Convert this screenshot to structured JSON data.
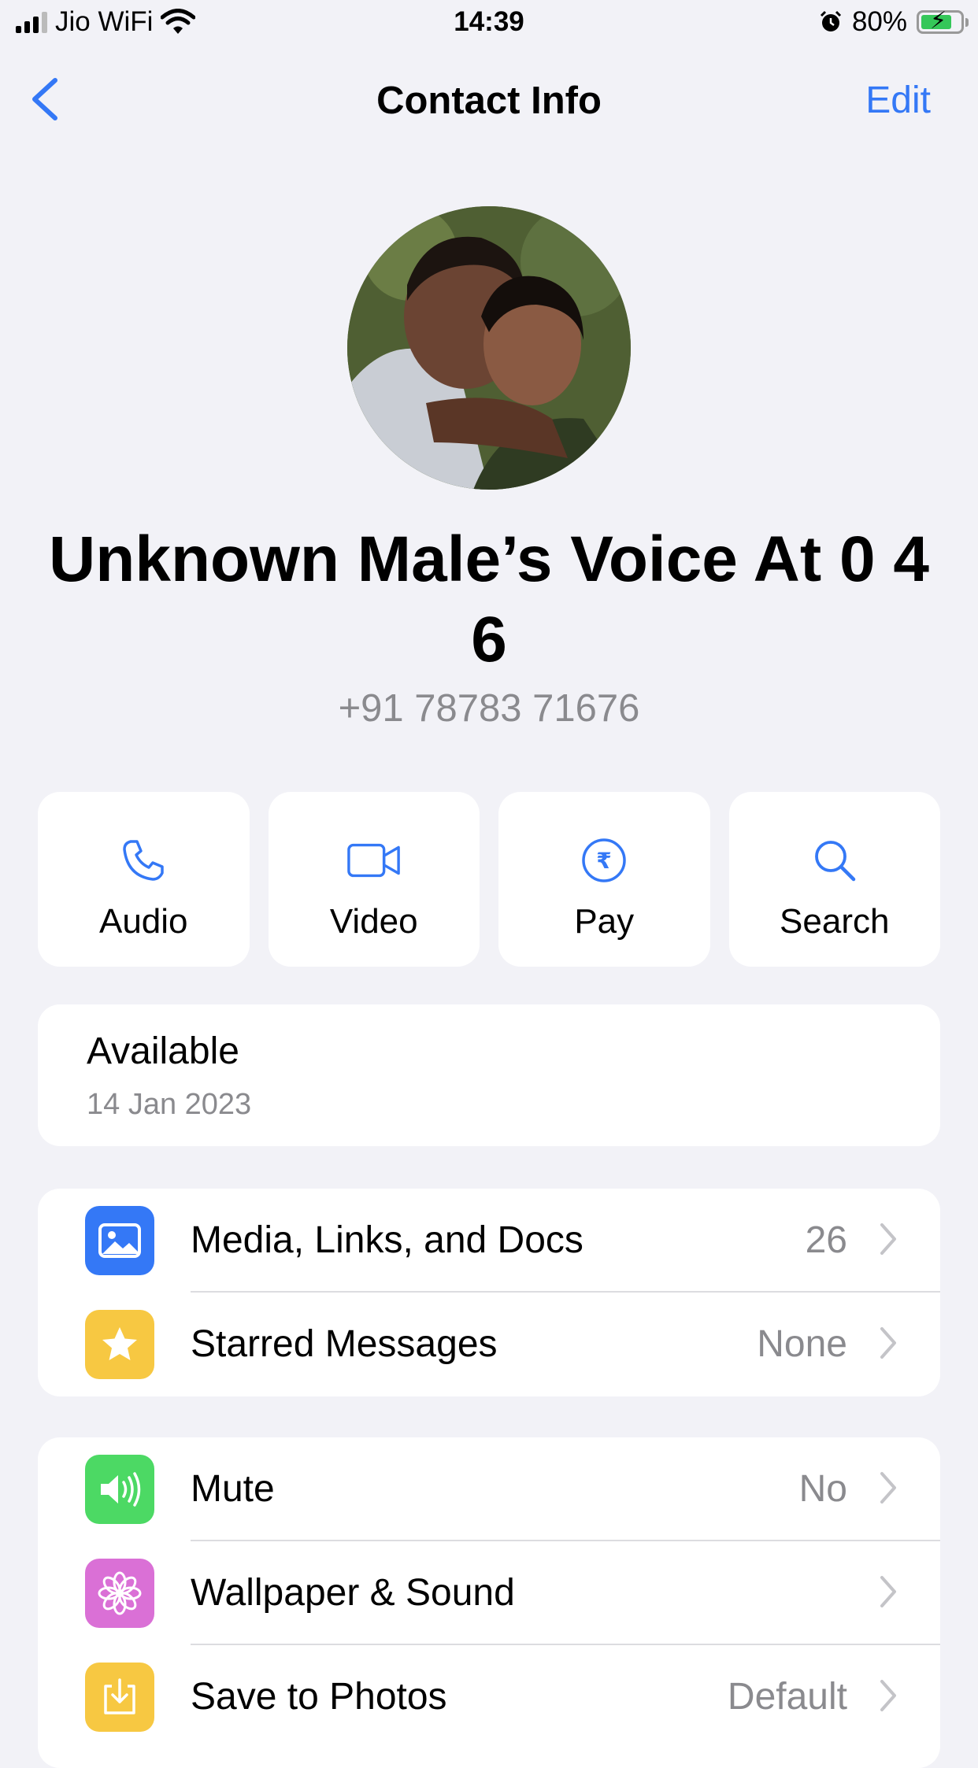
{
  "status_bar": {
    "carrier": "Jio WiFi",
    "time": "14:39",
    "battery": "80%",
    "battery_level": 0.8
  },
  "nav": {
    "title": "Contact Info",
    "edit": "Edit"
  },
  "contact": {
    "name": "Unknown Male’s Voice  At 0 4 6",
    "phone": "+91 78783 71676"
  },
  "actions": [
    {
      "label": "Audio",
      "icon": "phone-icon"
    },
    {
      "label": "Video",
      "icon": "video-icon"
    },
    {
      "label": "Pay",
      "icon": "rupee-icon"
    },
    {
      "label": "Search",
      "icon": "search-icon"
    }
  ],
  "about": {
    "status": "Available",
    "date": "14 Jan 2023"
  },
  "media_section": [
    {
      "label": "Media, Links, and Docs",
      "value": "26",
      "icon": "photo-icon",
      "color": "#3478f6"
    },
    {
      "label": "Starred Messages",
      "value": "None",
      "icon": "star-icon",
      "color": "#f7c842"
    }
  ],
  "settings_section": [
    {
      "label": "Mute",
      "value": "No",
      "icon": "speaker-icon",
      "color": "#4cd964"
    },
    {
      "label": "Wallpaper & Sound",
      "value": "",
      "icon": "flower-icon",
      "color": "#da70d6"
    },
    {
      "label": "Save to Photos",
      "value": "Default",
      "icon": "save-icon",
      "color": "#f7c842"
    }
  ],
  "colors": {
    "accent": "#3478f6",
    "background": "#f2f2f7",
    "secondary_text": "#8a8a8e"
  }
}
